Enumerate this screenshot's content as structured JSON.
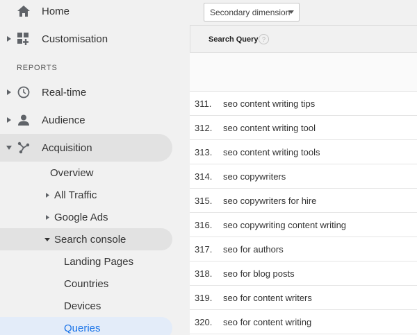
{
  "sidebar": {
    "home_label": "Home",
    "customisation_label": "Customisation",
    "reports_header": "REPORTS",
    "realtime_label": "Real-time",
    "audience_label": "Audience",
    "acquisition_label": "Acquisition",
    "acquisition_sub": {
      "overview": "Overview",
      "all_traffic": "All Traffic",
      "google_ads": "Google Ads",
      "search_console": "Search console",
      "search_console_sub": {
        "landing_pages": "Landing Pages",
        "countries": "Countries",
        "devices": "Devices",
        "queries": "Queries"
      }
    }
  },
  "toolbar": {
    "secondary_dimension": "Secondary dimension"
  },
  "table": {
    "column_header": "Search Query",
    "help_symbol": "?",
    "rows": [
      {
        "num": "311.",
        "query": "seo content writing tips"
      },
      {
        "num": "312.",
        "query": "seo content writing tool"
      },
      {
        "num": "313.",
        "query": "seo content writing tools"
      },
      {
        "num": "314.",
        "query": "seo copywriters"
      },
      {
        "num": "315.",
        "query": "seo copywriters for hire"
      },
      {
        "num": "316.",
        "query": "seo copywriting content writing"
      },
      {
        "num": "317.",
        "query": "seo for authors"
      },
      {
        "num": "318.",
        "query": "seo for blog posts"
      },
      {
        "num": "319.",
        "query": "seo for content writers"
      },
      {
        "num": "320.",
        "query": "seo for content writing"
      }
    ]
  },
  "colors": {
    "active_label": "#1a73e8",
    "icon": "#5f6368",
    "sidebar_bg": "#f1f1f1"
  }
}
